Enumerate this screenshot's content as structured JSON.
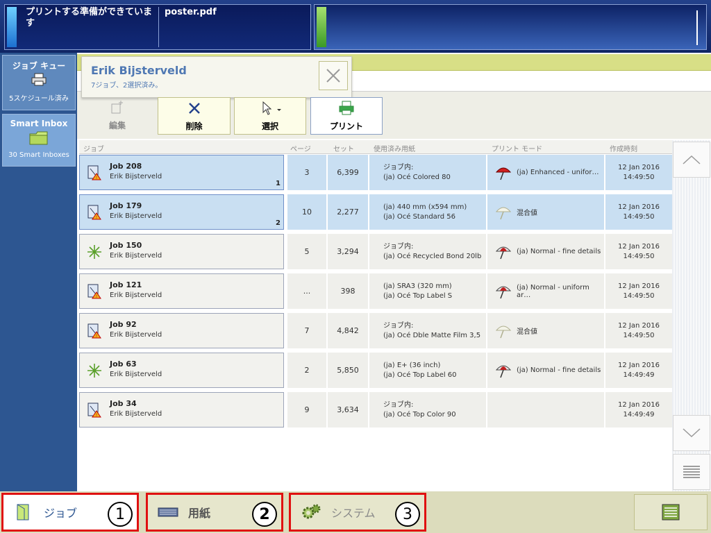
{
  "header": {
    "status_text": "プリントする準備ができています",
    "file_name": "poster.pdf"
  },
  "sidebar": {
    "items": [
      {
        "title": "ジョブ キュー",
        "sub": "5スケジュール済み"
      },
      {
        "title": "Smart Inbox",
        "sub": "30 Smart Inboxes"
      }
    ]
  },
  "user": {
    "name": "Erik Bijsterveld",
    "info": "7ジョブ、2選択済み。"
  },
  "toolbar": {
    "edit_label": "編集",
    "delete_label": "削除",
    "select_label": "選択",
    "print_label": "プリント"
  },
  "table": {
    "headers": [
      "ジョブ",
      "ページ",
      "セット",
      "使用済み用紙",
      "プリント モード",
      "作成時刻"
    ],
    "rows": [
      {
        "name": "Job 208",
        "owner": "Erik Bijsterveld",
        "idx": "1",
        "pages": "3",
        "sets": "6,399",
        "media1": "ジョブ内:",
        "media2": "(ja) Océ Colored 80",
        "mode": "(ja) Enhanced - unifor…",
        "date": "12 Jan 2016",
        "time": "14:49:50",
        "selected": true,
        "icon": "document-warning-icon",
        "mode_icon": "umbrella-enhanced-icon"
      },
      {
        "name": "Job 179",
        "owner": "Erik Bijsterveld",
        "idx": "2",
        "pages": "10",
        "sets": "2,277",
        "media1": "(ja) 440 mm (x594 mm)",
        "media2": "(ja) Océ Standard 56",
        "mode": "混合値",
        "date": "12 Jan 2016",
        "time": "14:49:50",
        "selected": true,
        "icon": "document-warning-icon",
        "mode_icon": "umbrella-mixed-icon"
      },
      {
        "name": "Job 150",
        "owner": "Erik Bijsterveld",
        "idx": "",
        "pages": "5",
        "sets": "3,294",
        "media1": "ジョブ内:",
        "media2": "(ja) Océ Recycled Bond 20lb",
        "mode": "(ja) Normal - fine details",
        "date": "12 Jan 2016",
        "time": "14:49:50",
        "selected": false,
        "icon": "new-job-star-icon",
        "mode_icon": "umbrella-normal-icon"
      },
      {
        "name": "Job 121",
        "owner": "Erik Bijsterveld",
        "idx": "",
        "pages": "...",
        "sets": "398",
        "media1": "(ja) SRA3 (320 mm)",
        "media2": "(ja) Océ Top Label S",
        "mode": "(ja) Normal - uniform ar…",
        "date": "12 Jan 2016",
        "time": "14:49:50",
        "selected": false,
        "icon": "document-warning-icon",
        "mode_icon": "umbrella-normal-icon"
      },
      {
        "name": "Job 92",
        "owner": "Erik Bijsterveld",
        "idx": "",
        "pages": "7",
        "sets": "4,842",
        "media1": "ジョブ内:",
        "media2": "(ja) Océ Dble Matte Film 3,5",
        "mode": "混合値",
        "date": "12 Jan 2016",
        "time": "14:49:50",
        "selected": false,
        "icon": "document-warning-icon",
        "mode_icon": "umbrella-mixed-icon"
      },
      {
        "name": "Job 63",
        "owner": "Erik Bijsterveld",
        "idx": "",
        "pages": "2",
        "sets": "5,850",
        "media1": "(ja) E+ (36 inch)",
        "media2": "(ja) Océ Top Label 60",
        "mode": "(ja) Normal - fine details",
        "date": "12 Jan 2016",
        "time": "14:49:49",
        "selected": false,
        "icon": "new-job-star-icon",
        "mode_icon": "umbrella-normal-icon"
      },
      {
        "name": "Job 34",
        "owner": "Erik Bijsterveld",
        "idx": "",
        "pages": "9",
        "sets": "3,634",
        "media1": "ジョブ内:",
        "media2": "(ja) Océ Top Color 90",
        "mode": "",
        "date": "12 Jan 2016",
        "time": "14:49:49",
        "selected": false,
        "icon": "document-warning-icon",
        "mode_icon": ""
      }
    ]
  },
  "bottom": {
    "jobs_label": "ジョブ",
    "paper_label": "用紙",
    "system_label": "システム",
    "callouts": [
      "1",
      "2",
      "3"
    ]
  },
  "colors": {
    "accent_blue": "#2d5691",
    "selected_row": "#c9dff2",
    "highlight_red": "#e01010",
    "header_bg": "#0f2564"
  }
}
